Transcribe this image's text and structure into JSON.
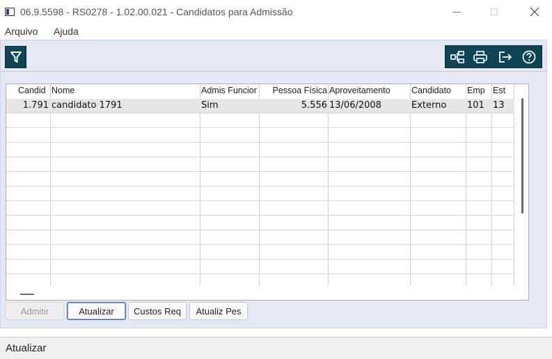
{
  "window": {
    "title": "06.9.5598 - RS0278 - 1.02.00.021 - Candidatos para Admissão",
    "icons": [
      "app-window-icon",
      "minimize-icon",
      "maximize-icon",
      "close-icon"
    ]
  },
  "menu": {
    "items": [
      "Arquivo",
      "Ajuda"
    ]
  },
  "toolbar": {
    "left_icons": [
      "filter-icon"
    ],
    "right_icons": [
      "hierarchy-icon",
      "print-icon",
      "exit-icon",
      "help-icon"
    ],
    "accent_color": "#0e4453"
  },
  "grid": {
    "columns": [
      "Candid",
      "Nome",
      "Admis Funcior",
      "Pessoa Física",
      "Aproveitamento",
      "Candidato",
      "Emp",
      "Est"
    ],
    "rows": [
      [
        "1.791",
        "candidato 1791",
        "Sim",
        "5.556",
        "13/06/2008",
        "Externo",
        "101",
        "13"
      ]
    ]
  },
  "buttons": {
    "admitir": "Admitir",
    "atualizar": "Atualizar",
    "custos_req": "Custos Req",
    "atualiz_pes": "Atualiz Pes"
  },
  "status": {
    "text": "Atualizar"
  }
}
